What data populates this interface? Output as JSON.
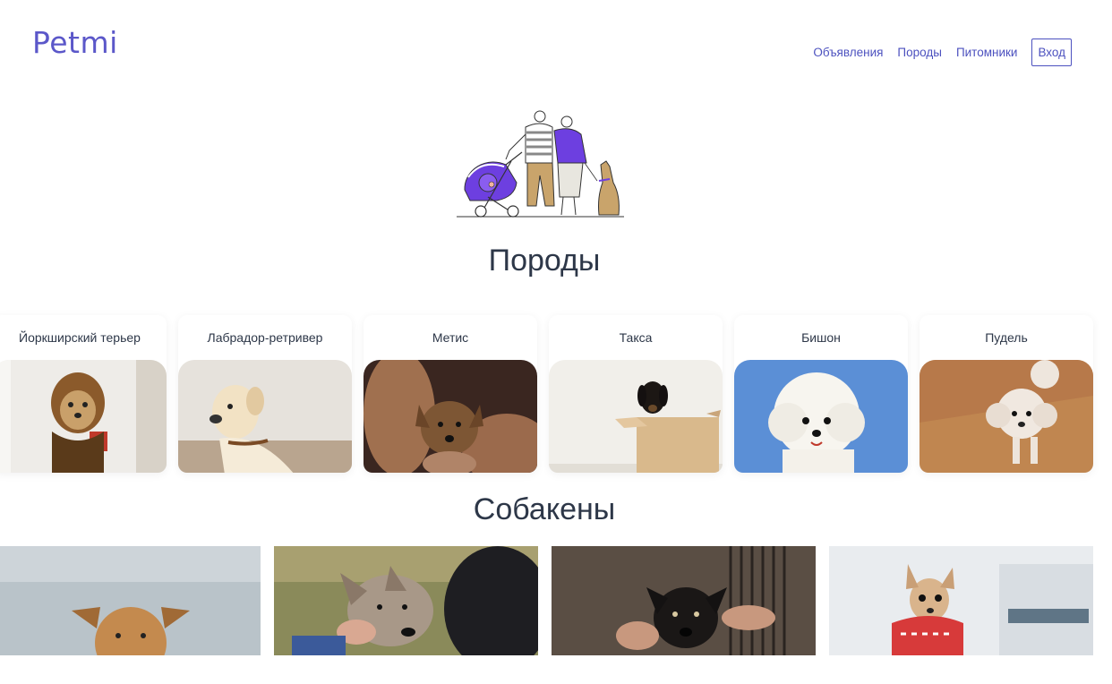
{
  "header": {
    "logo": "Petmi",
    "nav": [
      "Объявления",
      "Породы",
      "Питомники"
    ],
    "login": "Вход"
  },
  "breeds_section": {
    "title": "Породы",
    "items": [
      {
        "label": "Йоркширский терьер"
      },
      {
        "label": "Лабрадор-ретривер"
      },
      {
        "label": "Метис"
      },
      {
        "label": "Такса"
      },
      {
        "label": "Бишон"
      },
      {
        "label": "Пудель"
      }
    ]
  },
  "dogs_section": {
    "title": "Собакены"
  },
  "colors": {
    "brand": "#5b57c9",
    "link": "#4c51bf",
    "heading": "#2d3748"
  }
}
